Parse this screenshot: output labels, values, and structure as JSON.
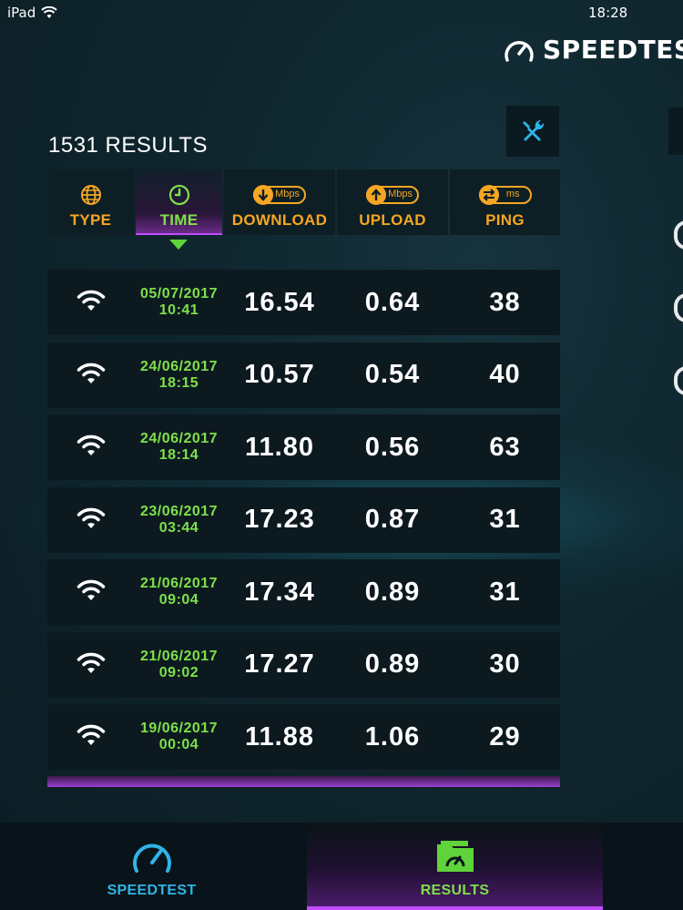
{
  "status": {
    "device": "iPad",
    "time": "18:28"
  },
  "brand": {
    "name": "SPEEDTEST"
  },
  "results_header": {
    "count_label": "1531 RESULTS"
  },
  "columns": [
    {
      "label": "TYPE",
      "icon": "globe-icon"
    },
    {
      "label": "TIME",
      "icon": "clock-icon",
      "sorted": true
    },
    {
      "label": "DOWNLOAD",
      "icon": "download-arrow-icon",
      "unit": "Mbps"
    },
    {
      "label": "UPLOAD",
      "icon": "upload-arrow-icon",
      "unit": "Mbps"
    },
    {
      "label": "PING",
      "icon": "ping-arrows-icon",
      "unit": "ms"
    }
  ],
  "rows": [
    {
      "type": "wifi",
      "date": "05/07/2017",
      "time": "10:41",
      "download": "16.54",
      "upload": "0.64",
      "ping": "38"
    },
    {
      "type": "wifi",
      "date": "24/06/2017",
      "time": "18:15",
      "download": "10.57",
      "upload": "0.54",
      "ping": "40"
    },
    {
      "type": "wifi",
      "date": "24/06/2017",
      "time": "18:14",
      "download": "11.80",
      "upload": "0.56",
      "ping": "63"
    },
    {
      "type": "wifi",
      "date": "23/06/2017",
      "time": "03:44",
      "download": "17.23",
      "upload": "0.87",
      "ping": "31"
    },
    {
      "type": "wifi",
      "date": "21/06/2017",
      "time": "09:04",
      "download": "17.34",
      "upload": "0.89",
      "ping": "31"
    },
    {
      "type": "wifi",
      "date": "21/06/2017",
      "time": "09:02",
      "download": "17.27",
      "upload": "0.89",
      "ping": "30"
    },
    {
      "type": "wifi",
      "date": "19/06/2017",
      "time": "00:04",
      "download": "11.88",
      "upload": "1.06",
      "ping": "29"
    }
  ],
  "tabs": [
    {
      "label": "SPEEDTEST",
      "icon": "speedometer-icon",
      "active": false
    },
    {
      "label": "RESULTS",
      "icon": "results-folder-icon",
      "active": true
    }
  ],
  "colors": {
    "accent_orange": "#f5a623",
    "accent_green": "#7fe04a",
    "accent_purple": "#c24dff",
    "accent_blue": "#2fb4e8"
  }
}
